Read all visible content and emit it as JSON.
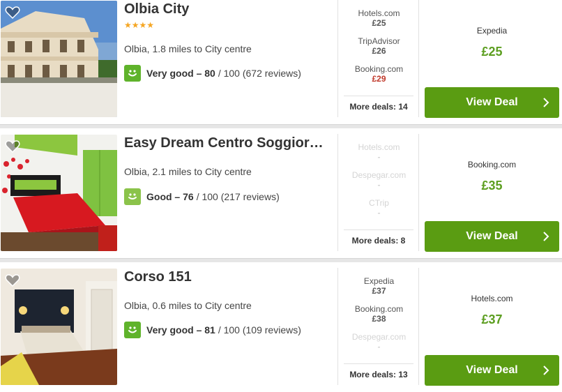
{
  "colors": {
    "accent_green": "#5a9c12",
    "price_green": "#5c9e20",
    "price_red": "#c0392b",
    "star_gold": "#f5a623",
    "smiley_very_good": "#5fb32b",
    "smiley_good": "#8bc34a"
  },
  "hotels": [
    {
      "name": "Olbia City",
      "stars": "★★★★",
      "location": "Olbia, 1.8 miles to City centre",
      "rating_label": "Very good – 80",
      "rating_rest": "/ 100 (672 reviews)",
      "offers": [
        {
          "site": "Hotels.com",
          "price": "£25"
        },
        {
          "site": "TripAdvisor",
          "price": "£26"
        },
        {
          "site": "Booking.com",
          "price": "£29"
        }
      ],
      "more_deals": "More deals: 14",
      "best_site": "Expedia",
      "best_price": "£25",
      "button": "View Deal"
    },
    {
      "name": "Easy Dream Centro Soggior…",
      "location": "Olbia, 2.1 miles to City centre",
      "rating_label": "Good – 76",
      "rating_rest": "/ 100 (217 reviews)",
      "offers": [
        {
          "site": "Hotels.com",
          "price": "-"
        },
        {
          "site": "Despegar.com",
          "price": "-"
        },
        {
          "site": "CTrip",
          "price": "-"
        }
      ],
      "more_deals": "More deals: 8",
      "best_site": "Booking.com",
      "best_price": "£35",
      "button": "View Deal"
    },
    {
      "name": "Corso 151",
      "location": "Olbia, 0.6 miles to City centre",
      "rating_label": "Very good – 81",
      "rating_rest": "/ 100 (109 reviews)",
      "offers": [
        {
          "site": "Expedia",
          "price": "£37"
        },
        {
          "site": "Booking.com",
          "price": "£38"
        },
        {
          "site": "Despegar.com",
          "price": "-"
        }
      ],
      "more_deals": "More deals: 13",
      "best_site": "Hotels.com",
      "best_price": "£37",
      "button": "View Deal"
    }
  ]
}
